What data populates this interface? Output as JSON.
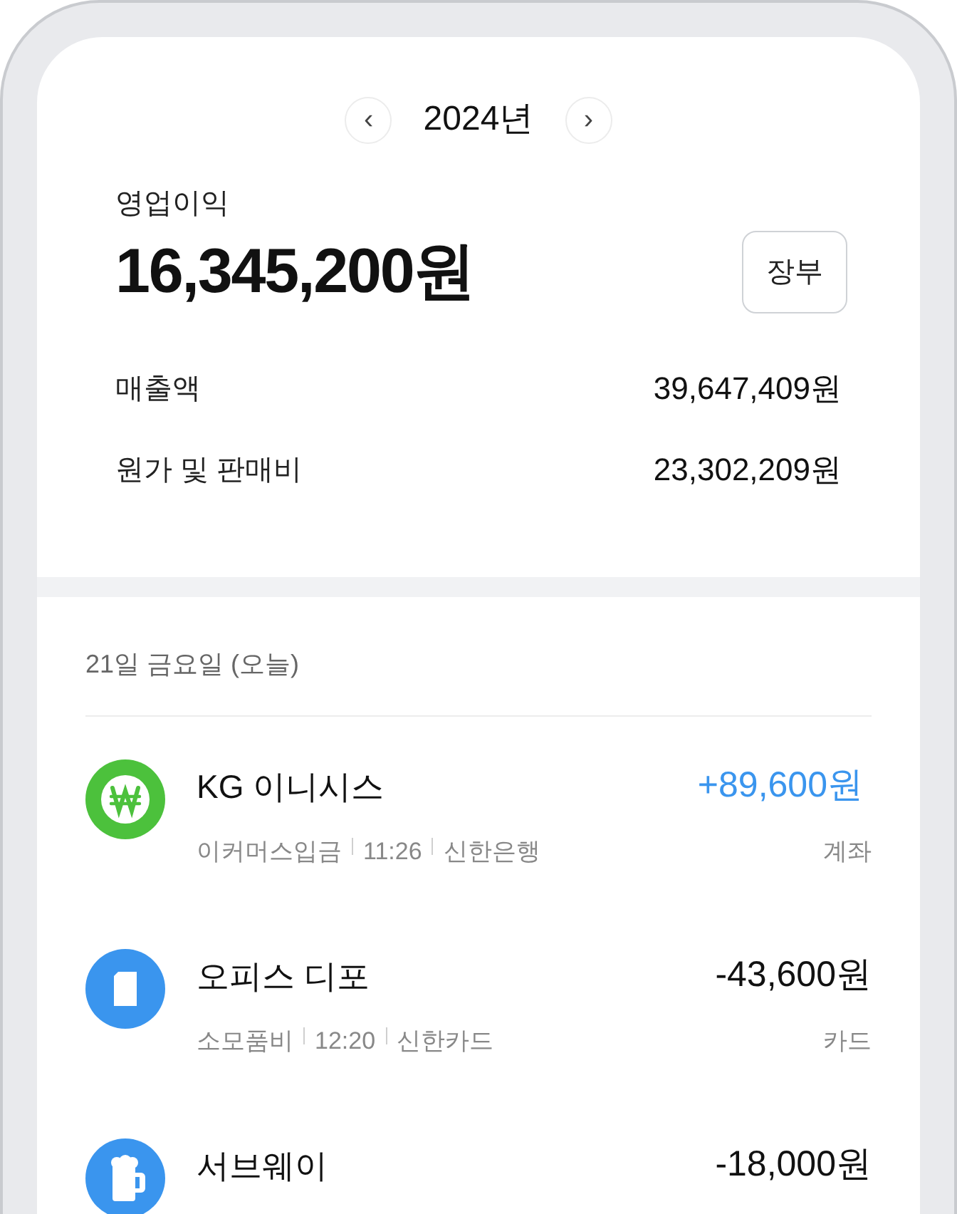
{
  "year_nav": {
    "prev": "‹",
    "year": "2024년",
    "next": "›"
  },
  "summary": {
    "label": "영업이익",
    "amount": "16,345,200원",
    "ledger_button": "장부",
    "rows": [
      {
        "label": "매출액",
        "value": "39,647,409원"
      },
      {
        "label": "원가 및 판매비",
        "value": "23,302,209원"
      }
    ]
  },
  "day_header": "21일 금요일 (오늘)",
  "transactions": [
    {
      "kind": "deposit",
      "color": "#4cc13c",
      "title": "KG 이니시스",
      "meta": [
        "이커머스입금",
        "11:26",
        "신한은행"
      ],
      "amount": "+89,600원",
      "income": true,
      "method": "계좌"
    },
    {
      "kind": "supplies",
      "color": "#3a95ee",
      "title": "오피스 디포",
      "meta": [
        "소모품비",
        "12:20",
        "신한카드"
      ],
      "amount": "-43,600원",
      "income": false,
      "method": "카드"
    },
    {
      "kind": "meal",
      "color": "#3a95ee",
      "title": "서브웨이",
      "amount": "-18,000원",
      "income": false
    }
  ]
}
